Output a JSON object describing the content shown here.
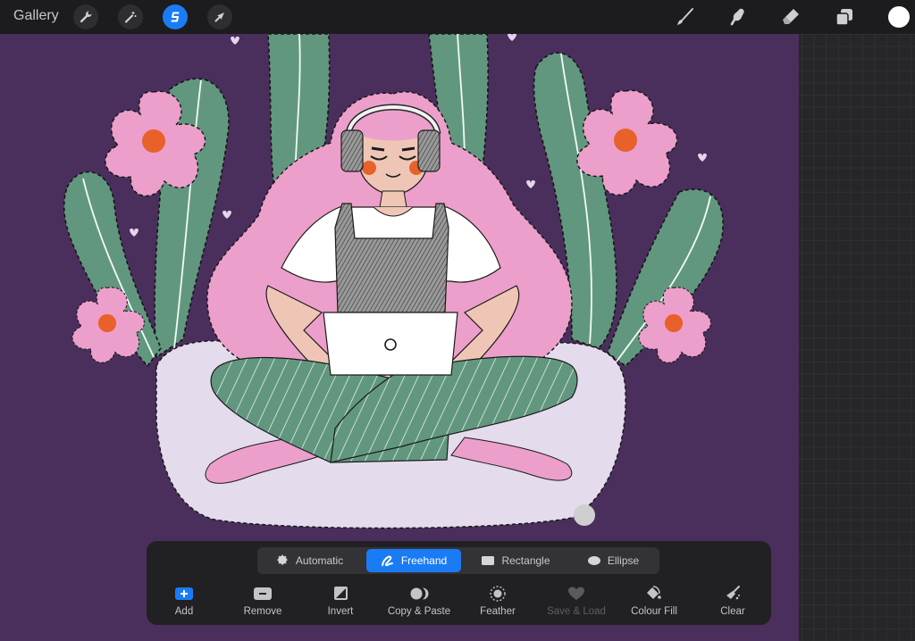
{
  "topbar": {
    "gallery_label": "Gallery",
    "left_tools": [
      {
        "name": "actions",
        "icon": "wrench-icon",
        "active": false
      },
      {
        "name": "adjustments",
        "icon": "magic-wand-icon",
        "active": false
      },
      {
        "name": "selection",
        "icon": "selection-s-icon",
        "active": true
      },
      {
        "name": "transform",
        "icon": "arrow-cursor-icon",
        "active": false
      }
    ],
    "right_tools": [
      {
        "name": "brush",
        "icon": "brush-icon"
      },
      {
        "name": "smudge",
        "icon": "smudge-finger-icon"
      },
      {
        "name": "eraser",
        "icon": "eraser-icon"
      },
      {
        "name": "layers",
        "icon": "layers-icon"
      }
    ],
    "current_color": "#ffffff",
    "accent_color": "#1a7cf5"
  },
  "selection_panel": {
    "modes": [
      {
        "label": "Automatic",
        "icon": "automatic-burst-icon",
        "active": false
      },
      {
        "label": "Freehand",
        "icon": "freehand-scribble-icon",
        "active": true
      },
      {
        "label": "Rectangle",
        "icon": "rectangle-icon",
        "active": false
      },
      {
        "label": "Ellipse",
        "icon": "ellipse-icon",
        "active": false
      }
    ],
    "actions": [
      {
        "label": "Add",
        "icon": "add-plus-icon",
        "enabled": true
      },
      {
        "label": "Remove",
        "icon": "remove-minus-icon",
        "enabled": true
      },
      {
        "label": "Invert",
        "icon": "invert-icon",
        "enabled": true
      },
      {
        "label": "Copy & Paste",
        "icon": "copy-paste-icon",
        "enabled": true
      },
      {
        "label": "Feather",
        "icon": "feather-icon",
        "enabled": true
      },
      {
        "label": "Save & Load",
        "icon": "heart-icon",
        "enabled": false
      },
      {
        "label": "Colour Fill",
        "icon": "paint-bucket-icon",
        "enabled": true
      },
      {
        "label": "Clear",
        "icon": "broom-icon",
        "enabled": true
      }
    ]
  },
  "canvas": {
    "background_color": "#4a2f5c",
    "artwork": "Girl with pink hair and headphones sitting cross-legged with a laptop among green cactus leaves and pink flowers",
    "selection_active": true
  }
}
